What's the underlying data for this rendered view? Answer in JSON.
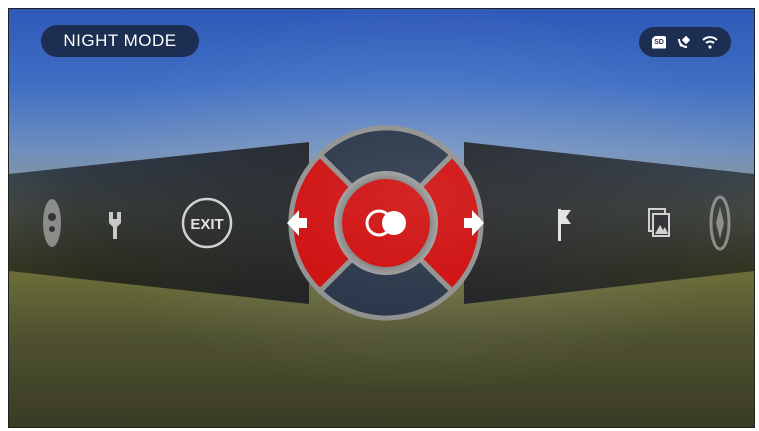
{
  "status_bar": {
    "mode_label": "NIGHT MODE",
    "icons": [
      "sd-card-icon",
      "satellite-icon",
      "wifi-icon"
    ],
    "sd_text": "SD"
  },
  "menu": {
    "exit_label": "EXIT",
    "left_items": [
      "color-palette-icon",
      "wrench-icon",
      "exit-button"
    ],
    "right_items": [
      "flag-icon",
      "gallery-icon",
      "compass-icon"
    ],
    "center": {
      "up": "up-segment",
      "down": "down-segment",
      "left": "left-arrow-button",
      "right": "right-arrow-button",
      "ok": "night-mode-toggle-icon"
    }
  },
  "colors": {
    "accent_red": "#cc0000",
    "pill_bg": "#1c2e52",
    "dark_segment": "#1e2b3f",
    "ring": "#8a8a8a"
  }
}
